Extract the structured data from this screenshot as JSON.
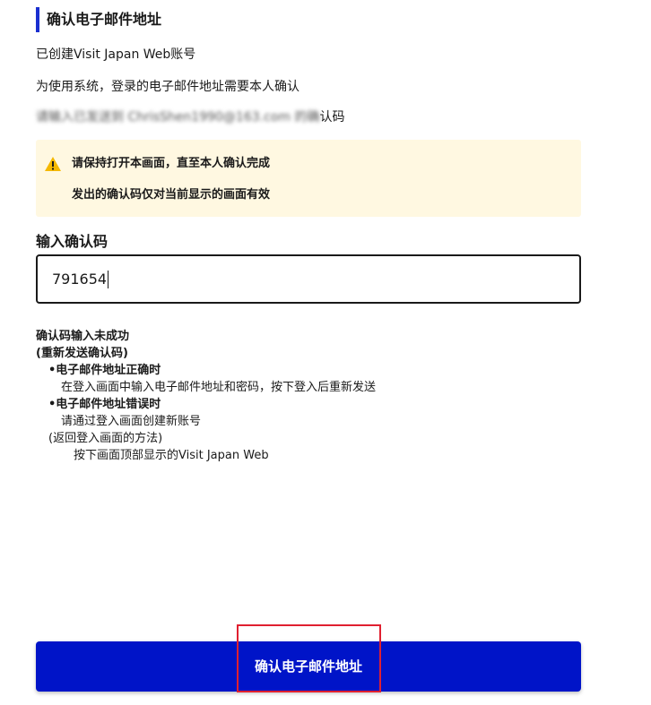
{
  "page": {
    "title": "确认电子邮件地址",
    "account_created": "已创建Visit Japan Web账号",
    "instruction": "为使用系统，登录的电子邮件地址需要本人确认",
    "code_sent_prefix": "请输入已发送到",
    "code_sent_email": "ChrisShen1990@163.com",
    "code_sent_suffix": "的确认码"
  },
  "notice": {
    "icon": "warning-icon",
    "line1": "请保持打开本画面，直至本人确认完成",
    "line2": "发出的确认码仅对当前显示的画面有效",
    "background": "#fff8e1",
    "icon_color": "#f5b800"
  },
  "code_field": {
    "label": "输入确认码",
    "value": "791654"
  },
  "help": {
    "heading": "确认码输入未成功",
    "subheading": "(重新发送确认码)",
    "case1_title": "•电子邮件地址正确时",
    "case1_text": "在登入画面中输入电子邮件地址和密码，按下登入后重新发送",
    "case2_title": "•电子邮件地址错误时",
    "case2_text": "请通过登入画面创建新账号",
    "return_title": "(返回登入画面的方法)",
    "return_text": "按下画面顶部显示的Visit Japan Web"
  },
  "button": {
    "label": "确认电子邮件地址",
    "color": "#0014c8"
  },
  "colors": {
    "accent": "#1a2fd0",
    "highlight": "#e02030"
  }
}
